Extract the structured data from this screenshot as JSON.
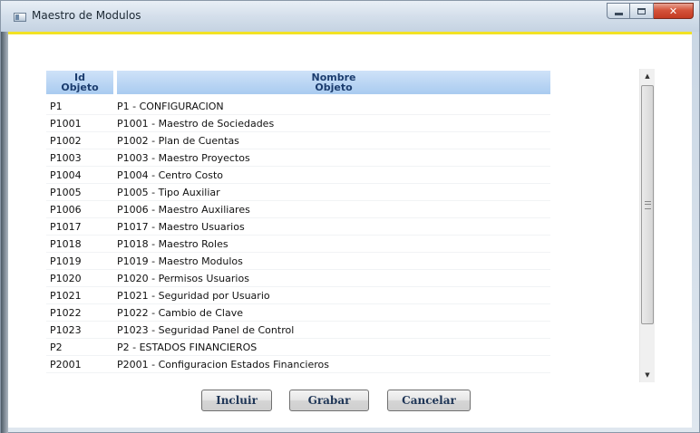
{
  "window": {
    "title": "Maestro de Modulos",
    "caption": {
      "minimize": "",
      "maximize": "",
      "close": "✕"
    }
  },
  "grid": {
    "columns": [
      {
        "line1": "Id",
        "line2": "Objeto"
      },
      {
        "line1": "Nombre",
        "line2": "Objeto"
      }
    ],
    "rows": [
      {
        "id": "P1",
        "name": "P1 - CONFIGURACION"
      },
      {
        "id": "P1001",
        "name": "P1001 - Maestro de Sociedades"
      },
      {
        "id": "P1002",
        "name": "P1002 - Plan de Cuentas"
      },
      {
        "id": "P1003",
        "name": "P1003 - Maestro Proyectos"
      },
      {
        "id": "P1004",
        "name": "P1004 - Centro Costo"
      },
      {
        "id": "P1005",
        "name": "P1005 - Tipo Auxiliar"
      },
      {
        "id": "P1006",
        "name": "P1006 - Maestro Auxiliares"
      },
      {
        "id": "P1017",
        "name": "P1017 - Maestro Usuarios"
      },
      {
        "id": "P1018",
        "name": "P1018 - Maestro Roles"
      },
      {
        "id": "P1019",
        "name": "P1019 - Maestro Modulos"
      },
      {
        "id": "P1020",
        "name": "P1020 - Permisos Usuarios"
      },
      {
        "id": "P1021",
        "name": "P1021 - Seguridad por Usuario"
      },
      {
        "id": "P1022",
        "name": "P1022 - Cambio de Clave"
      },
      {
        "id": "P1023",
        "name": "P1023 - Seguridad Panel de Control"
      },
      {
        "id": "P2",
        "name": "P2 - ESTADOS FINANCIEROS"
      },
      {
        "id": "P2001",
        "name": "P2001 - Configuracion Estados Financieros"
      }
    ]
  },
  "scrollbar": {
    "up": "▲",
    "down": "▼"
  },
  "actions": {
    "incluir": "Incluir",
    "grabar": "Grabar",
    "cancelar": "Cancelar"
  },
  "colors": {
    "header": "#a9cbf0",
    "header_text": "#1b3c6e",
    "accent_line": "#f2e224",
    "close_button": "#c33a22"
  }
}
